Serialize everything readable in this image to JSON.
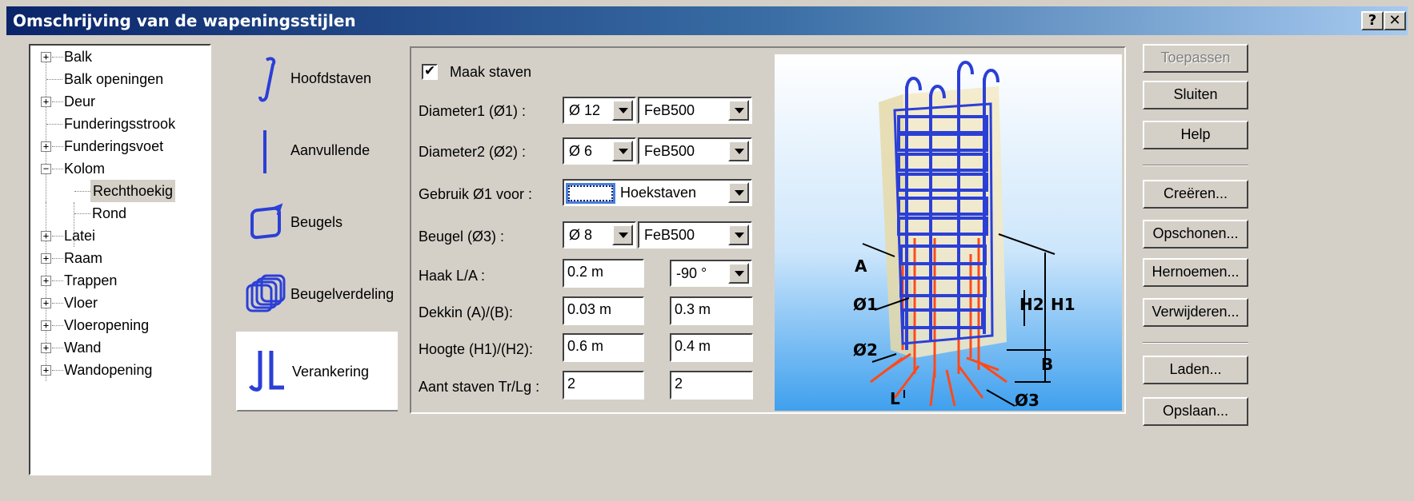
{
  "window": {
    "title": "Omschrijving van de wapeningsstijlen",
    "help_label": "?",
    "close_label": "✕"
  },
  "tree": {
    "items": [
      {
        "label": "Balk",
        "expander": "+"
      },
      {
        "label": "Balk openingen",
        "expander": ""
      },
      {
        "label": "Deur",
        "expander": "+"
      },
      {
        "label": "Funderingsstrook",
        "expander": ""
      },
      {
        "label": "Funderingsvoet",
        "expander": "+"
      },
      {
        "label": "Kolom",
        "expander": "−"
      },
      {
        "label": "Rechthoekig",
        "expander": "",
        "selected": true
      },
      {
        "label": "Rond",
        "expander": ""
      },
      {
        "label": "Latei",
        "expander": "+"
      },
      {
        "label": "Raam",
        "expander": "+"
      },
      {
        "label": "Trappen",
        "expander": "+"
      },
      {
        "label": "Vloer",
        "expander": "+"
      },
      {
        "label": "Vloeropening",
        "expander": "+"
      },
      {
        "label": "Wand",
        "expander": "+"
      },
      {
        "label": "Wandopening",
        "expander": "+"
      }
    ]
  },
  "tabs": [
    {
      "label": "Hoofdstaven",
      "icon": "main-bar-icon"
    },
    {
      "label": "Aanvullende",
      "icon": "additional-bar-icon"
    },
    {
      "label": "Beugels",
      "icon": "stirrup-icon"
    },
    {
      "label": "Beugelverdeling",
      "icon": "stirrup-distribution-icon"
    },
    {
      "label": "Verankering",
      "icon": "anchorage-icon",
      "active": true
    }
  ],
  "form": {
    "maak_staven": {
      "label": "Maak staven",
      "checked": true
    },
    "diameter1": {
      "label": "Diameter1 (Ø1) :",
      "diameter": "Ø 12",
      "grade": "FeB500"
    },
    "diameter2": {
      "label": "Diameter2 (Ø2) :",
      "diameter": "Ø 6",
      "grade": "FeB500"
    },
    "gebruik": {
      "label": "Gebruik Ø1 voor :",
      "value": "Hoekstaven"
    },
    "beugel": {
      "label": "Beugel (Ø3) :",
      "diameter": "Ø 8",
      "grade": "FeB500"
    },
    "haak": {
      "label": "Haak L/A :",
      "value1": "0.2 m",
      "value2": "-90 °"
    },
    "dekkin": {
      "label": "Dekkin (A)/(B):",
      "value1": "0.03 m",
      "value2": "0.3 m"
    },
    "hoogte": {
      "label": "Hoogte (H1)/(H2):",
      "value1": "0.6 m",
      "value2": "0.4 m"
    },
    "aant": {
      "label": "Aant staven Tr/Lg :",
      "value1": "2",
      "value2": "2"
    }
  },
  "illustration": {
    "labels": {
      "A": "A",
      "phi1": "Ø1",
      "phi2": "Ø2",
      "phi3": "Ø3",
      "H1": "H1",
      "H2": "H2",
      "B": "B",
      "L": "L"
    }
  },
  "buttons": {
    "toepassen": "Toepassen",
    "sluiten": "Sluiten",
    "help": "Help",
    "creeren": "Creëren...",
    "opschonen": "Opschonen...",
    "hernoemen": "Hernoemen...",
    "verwijderen": "Verwijderen...",
    "laden": "Laden...",
    "opslaan": "Opslaan..."
  },
  "colors": {
    "accent": "#0a246a",
    "rebar_blue": "#2b3fd6",
    "rebar_red": "#ff4a1a",
    "background_sky": "#4ba8f0"
  }
}
